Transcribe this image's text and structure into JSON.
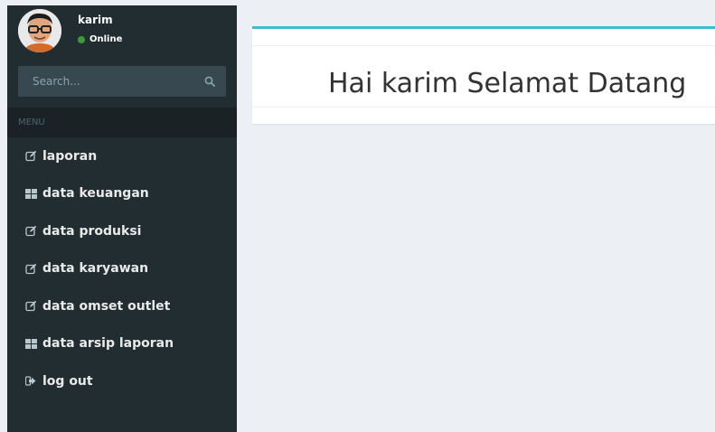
{
  "user": {
    "name": "karim",
    "status": "Online",
    "status_color": "#3c9a3c"
  },
  "search": {
    "placeholder": "Search...",
    "icon": "search-icon"
  },
  "menu": {
    "header": "MENU",
    "items": [
      {
        "label": "laporan",
        "icon": "edit-icon"
      },
      {
        "label": "data keuangan",
        "icon": "table-icon"
      },
      {
        "label": "data produksi",
        "icon": "edit-icon"
      },
      {
        "label": "data karyawan",
        "icon": "edit-icon"
      },
      {
        "label": "data omset outlet",
        "icon": "edit-icon"
      },
      {
        "label": "data arsip laporan",
        "icon": "table-icon"
      },
      {
        "label": "log out",
        "icon": "sign-out-icon"
      }
    ]
  },
  "main": {
    "welcome": "Hai karim Selamat Datang",
    "accent_color": "#3bc0d3"
  },
  "colors": {
    "sidebar": "#222d32",
    "sidebar_header": "#1a2226",
    "background": "#ecf0f5"
  }
}
